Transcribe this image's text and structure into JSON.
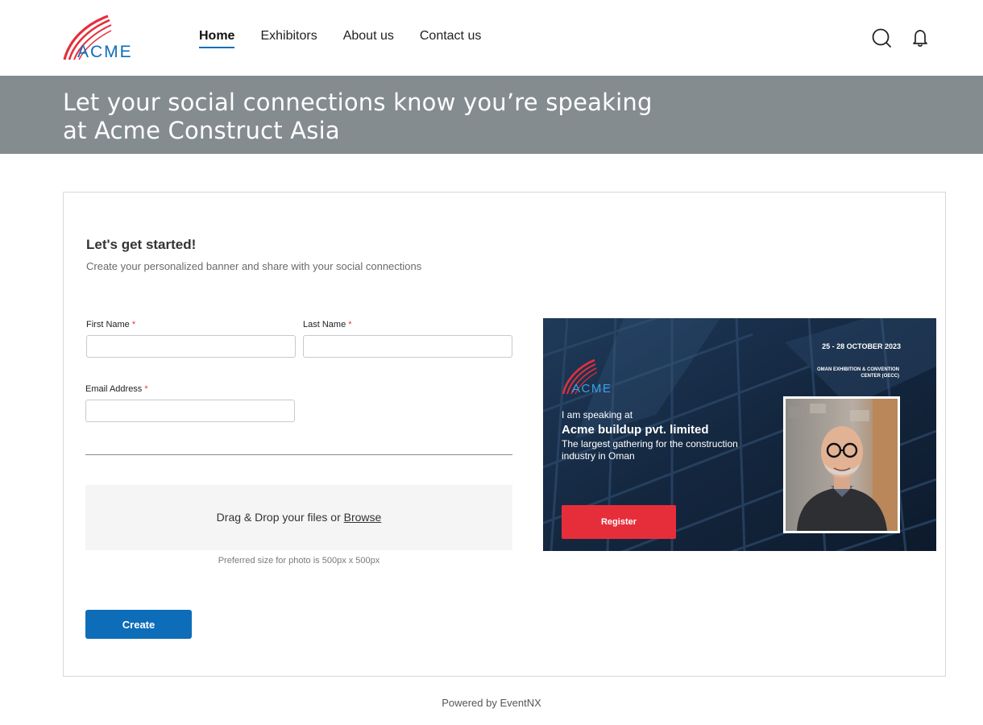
{
  "header": {
    "logo_text": "ACME",
    "nav": [
      {
        "label": "Home",
        "active": true
      },
      {
        "label": "Exhibitors",
        "active": false
      },
      {
        "label": "About us",
        "active": false
      },
      {
        "label": "Contact us",
        "active": false
      }
    ],
    "icons": [
      "search-icon",
      "bell-icon"
    ]
  },
  "banner": {
    "title": "Let your social connections know you’re speaking at Acme Construct Asia"
  },
  "form": {
    "title": "Let's get started!",
    "subtitle": "Create your personalized banner and share with your social connections",
    "first_name_label": "First Name",
    "last_name_label": "Last Name",
    "email_label": "Email Address",
    "required_mark": "*",
    "first_name_value": "",
    "last_name_value": "",
    "email_value": "",
    "dropzone_text": "Drag & Drop your files or",
    "dropzone_link": "Browse",
    "dropzone_hint": "Preferred size for photo is 500px x 500px",
    "create_label": "Create"
  },
  "preview": {
    "date": "25 - 28 OCTOBER 2023",
    "venue": "OMAN EXHIBITION & CONVENTION CENTER (OECC)",
    "logo_text": "ACME",
    "line1": "I am speaking at",
    "line2": "Acme buildup pvt. limited",
    "line3": "The largest gathering for the construction industry in Oman",
    "register_label": "Register"
  },
  "footer": {
    "text": "Powered by EventNX"
  },
  "colors": {
    "brand_red": "#e62e3a",
    "brand_blue": "#0d6db8",
    "banner_gray": "#858c90",
    "preview_navy": "#14253b"
  }
}
